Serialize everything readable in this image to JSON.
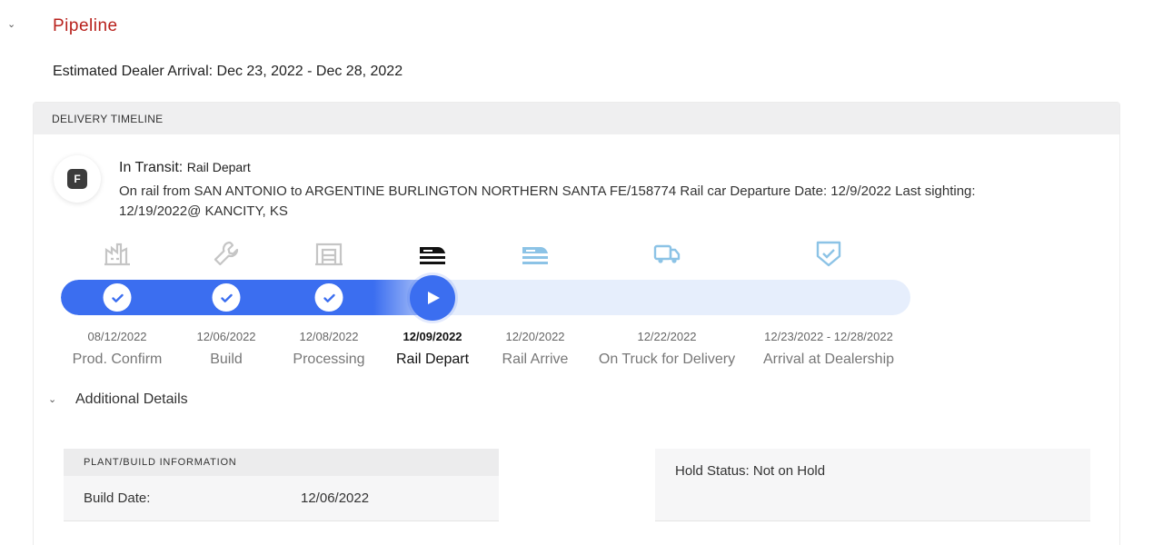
{
  "section": {
    "title": "Pipeline",
    "arrival_label": "Estimated Dealer Arrival: Dec 23, 2022 - Dec 28, 2022"
  },
  "timeline": {
    "header": "DELIVERY TIMELINE",
    "badge_letter": "F",
    "status_title": "In Transit:",
    "status_sub": "Rail Depart",
    "status_desc": "On rail from SAN ANTONIO to ARGENTINE BURLINGTON NORTHERN SANTA FE/158774 Rail car Departure Date: 12/9/2022 Last sighting: 12/19/2022@ KANCITY, KS",
    "progress_fraction": 0.46,
    "steps": [
      {
        "date": "08/12/2022",
        "label": "Prod. Confirm",
        "icon": "factory-icon",
        "state": "done"
      },
      {
        "date": "12/06/2022",
        "label": "Build",
        "icon": "wrench-icon",
        "state": "done"
      },
      {
        "date": "12/08/2022",
        "label": "Processing",
        "icon": "processing-icon",
        "state": "done"
      },
      {
        "date": "12/09/2022",
        "label": "Rail Depart",
        "icon": "train-icon",
        "state": "current"
      },
      {
        "date": "12/20/2022",
        "label": "Rail Arrive",
        "icon": "train-icon",
        "state": "upcoming"
      },
      {
        "date": "12/22/2022",
        "label": "On Truck for Delivery",
        "icon": "truck-icon",
        "state": "upcoming"
      },
      {
        "date": "12/23/2022 - 12/28/2022",
        "label": "Arrival at Dealership",
        "icon": "shield-check-icon",
        "state": "upcoming"
      }
    ]
  },
  "details": {
    "title": "Additional Details",
    "plant_header": "PLANT/BUILD INFORMATION",
    "build_date_label": "Build Date:",
    "build_date_value": "12/06/2022",
    "hold_status": "Hold Status: Not on Hold"
  },
  "colors": {
    "accent_red": "#b8211c",
    "progress_blue": "#3b6ef0",
    "track_light": "#e6eefc",
    "upcoming_icon": "#8cc3e6"
  }
}
